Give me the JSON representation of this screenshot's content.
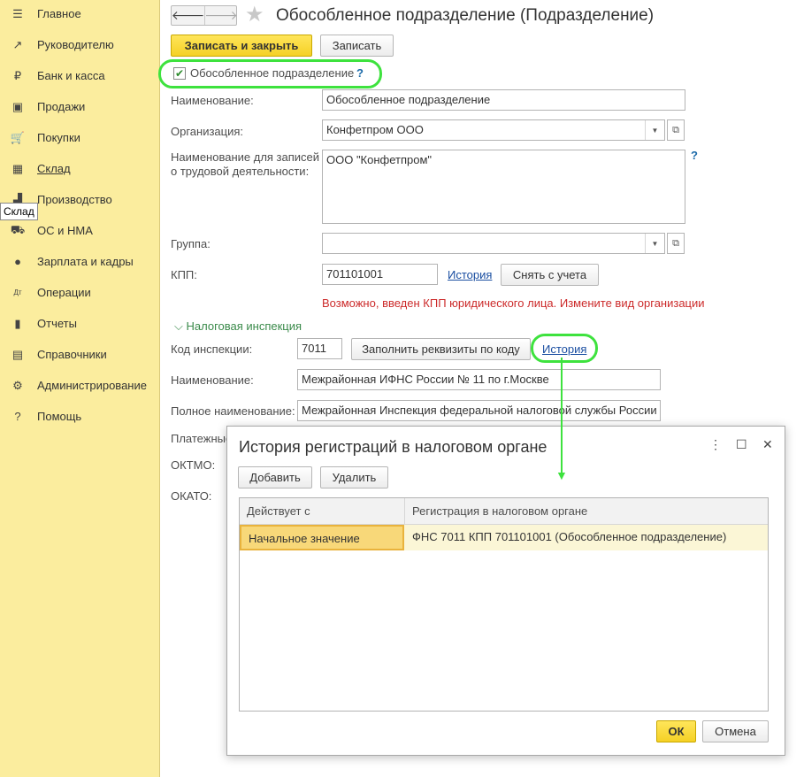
{
  "sidebar": {
    "items": [
      {
        "label": "Главное",
        "icon": "☰",
        "icon_name": "menu-icon"
      },
      {
        "label": "Руководителю",
        "icon": "↗",
        "icon_name": "trend-icon"
      },
      {
        "label": "Банк и касса",
        "icon": "₽",
        "icon_name": "ruble-icon"
      },
      {
        "label": "Продажи",
        "icon": "▣",
        "icon_name": "bag-icon"
      },
      {
        "label": "Покупки",
        "icon": "🛒",
        "icon_name": "cart-icon"
      },
      {
        "label": "Склад",
        "icon": "▦",
        "icon_name": "warehouse-icon"
      },
      {
        "label": "Производство",
        "icon": "▟",
        "icon_name": "factory-icon"
      },
      {
        "label": "ОС и НМА",
        "icon": "⛟",
        "icon_name": "truck-icon"
      },
      {
        "label": "Зарплата и кадры",
        "icon": "●",
        "icon_name": "person-icon"
      },
      {
        "label": "Операции",
        "icon": "Дт",
        "icon_name": "debit-credit-icon"
      },
      {
        "label": "Отчеты",
        "icon": "▮",
        "icon_name": "reports-icon"
      },
      {
        "label": "Справочники",
        "icon": "▤",
        "icon_name": "books-icon"
      },
      {
        "label": "Администрирование",
        "icon": "⚙",
        "icon_name": "gear-icon"
      },
      {
        "label": "Помощь",
        "icon": "?",
        "icon_name": "help-icon"
      }
    ],
    "tooltip": "Склад"
  },
  "header": {
    "title": "Обособленное подразделение (Подразделение)",
    "save_close_label": "Записать и закрыть",
    "save_label": "Записать"
  },
  "form": {
    "separate_checkbox_label": "Обособленное подразделение",
    "separate_checked": "✔",
    "help_mark": "?",
    "name_label": "Наименование:",
    "name_value": "Обособленное подразделение",
    "org_label": "Организация:",
    "org_value": "Конфетпром ООО",
    "labor_label_1": "Наименование для записей",
    "labor_label_2": "о трудовой деятельности:",
    "labor_value": "ООО \"Конфетпром\"",
    "group_label": "Группа:",
    "group_value": "",
    "kpp_label": "КПП:",
    "kpp_value": "701101001",
    "kpp_history": "История",
    "deregister_label": "Снять с учета",
    "kpp_error": "Возможно, введен КПП юридического лица. Измените вид организации"
  },
  "tax": {
    "section_label": "Налоговая инспекция",
    "code_label": "Код инспекции:",
    "code_value": "7011",
    "fill_label": "Заполнить реквизиты по коду",
    "history_link": "История",
    "name_label": "Наименование:",
    "name_value": "Межрайонная ИФНС России № 11 по г.Москве",
    "full_name_label": "Полное наименование:",
    "full_name_value": "Межрайонная Инспекция федеральной налоговой службы России №",
    "payment_label": "Платежные",
    "oktmo_label": "ОКТМО:",
    "okato_label": "ОКАТО:"
  },
  "dialog": {
    "title": "История регистраций в налоговом органе",
    "more_icon": "⋮",
    "maximize_icon": "☐",
    "close_icon": "✕",
    "add_label": "Добавить",
    "delete_label": "Удалить",
    "columns": [
      "Действует с",
      "Регистрация в налоговом органе"
    ],
    "rows": [
      [
        "Начальное значение",
        "ФНС 7011 КПП 701101001 (Обособленное подразделение)"
      ]
    ],
    "ok_label": "ОК",
    "cancel_label": "Отмена"
  }
}
